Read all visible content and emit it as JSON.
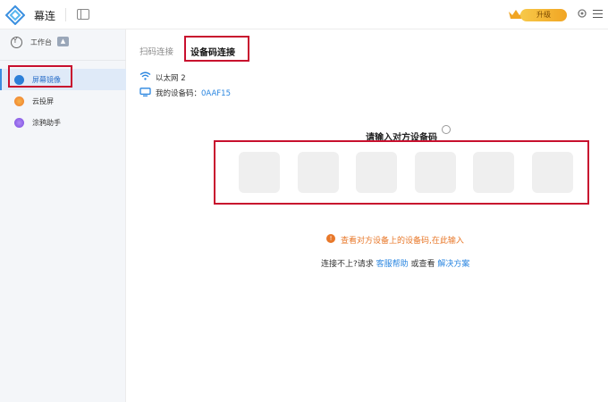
{
  "app": {
    "name": "幕连",
    "upgrade_label": "升级"
  },
  "sidebar": {
    "workspace_label": "工作台",
    "items": [
      {
        "label": "屏幕镜像",
        "active": true,
        "color": "#2b7fd8"
      },
      {
        "label": "云投屏",
        "active": false,
        "color": "#f07b2a"
      },
      {
        "label": "涂鸦助手",
        "active": false,
        "color": "#7b4ce0"
      }
    ]
  },
  "main": {
    "tabs": [
      {
        "label": "扫码连接"
      },
      {
        "label": "设备码连接",
        "active": true
      }
    ],
    "network_label": "以太网 2",
    "device_code_prefix": "我的设备码：",
    "device_code": "0AAF15",
    "prompt_title": "请输入对方设备码",
    "hint": "查看对方设备上的设备码,在此输入",
    "help": {
      "prefix": "连接不上?请求 ",
      "link1": "客服帮助",
      "middle": " 或查看 ",
      "link2": "解决方案"
    }
  },
  "colors": {
    "accent": "#2a86e0",
    "highlight": "#c8102e",
    "warning": "#e8782a"
  }
}
